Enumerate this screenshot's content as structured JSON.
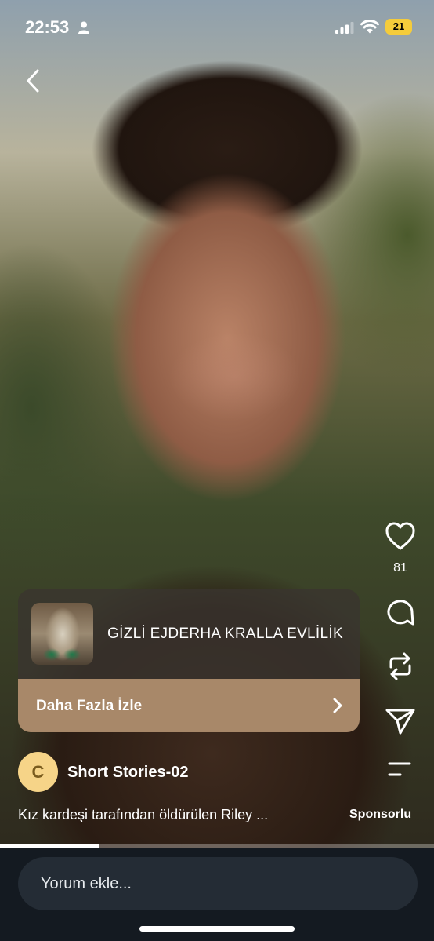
{
  "status": {
    "time": "22:53",
    "battery": "21"
  },
  "rail": {
    "like_count": "81"
  },
  "promo": {
    "title": "GİZLİ EJDERHA KRALLA EVLİLİK",
    "cta": "Daha Fazla İzle"
  },
  "channel": {
    "avatar_letter": "C",
    "name": "Short Stories-02"
  },
  "description": "Kız kardeşi tarafından öldürülen Riley ...",
  "sponsor_label": "Sponsorlu",
  "video_progress": 0.23,
  "comment": {
    "placeholder": "Yorum ekle..."
  },
  "icons": [
    "person-icon",
    "signal-icon",
    "wifi-icon",
    "back-arrow-icon",
    "heart-icon",
    "comment-icon",
    "share-icon",
    "send-icon",
    "menu-icon",
    "chevron-right-icon"
  ]
}
